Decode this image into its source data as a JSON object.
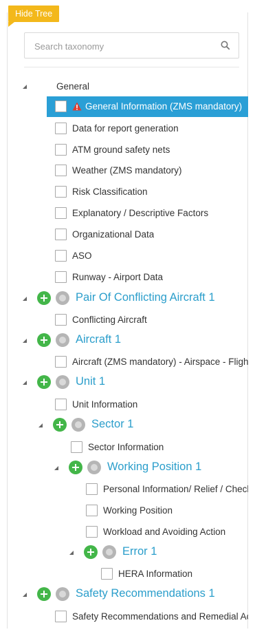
{
  "toggle": {
    "label": "Hide Tree"
  },
  "search": {
    "placeholder": "Search taxonomy"
  },
  "tree": {
    "general": "General",
    "general_information": "General Information (ZMS mandatory)",
    "data_report": "Data for report generation",
    "atm_safety_nets": "ATM ground safety nets",
    "weather": "Weather (ZMS mandatory)",
    "risk_classification": "Risk Classification",
    "explanatory": "Explanatory / Descriptive Factors",
    "organizational": "Organizational Data",
    "aso": "ASO",
    "runway": "Runway - Airport Data",
    "pair_conflicting": "Pair Of Conflicting Aircraft 1",
    "conflicting_aircraft": "Conflicting Aircraft",
    "aircraft": "Aircraft 1",
    "aircraft_zms": "Aircraft (ZMS mandatory) - Airspace - Flight Data",
    "unit": "Unit 1",
    "unit_information": "Unit Information",
    "sector": "Sector 1",
    "sector_information": "Sector Information",
    "working_position": "Working Position 1",
    "personal_information": "Personal Information/ Relief / Check",
    "working_position_item": "Working Position",
    "workload": "Workload and Avoiding Action",
    "error": "Error 1",
    "hera_information": "HERA Information",
    "safety_recommendations": "Safety Recommendations 1",
    "safety_recommendations_item": "Safety Recommendations and Remedial Actions"
  },
  "colors": {
    "accent": "#2a9fd6",
    "link": "#2b9ecb",
    "add_green": "#43b649",
    "toggle_yellow": "#f3b81b"
  }
}
